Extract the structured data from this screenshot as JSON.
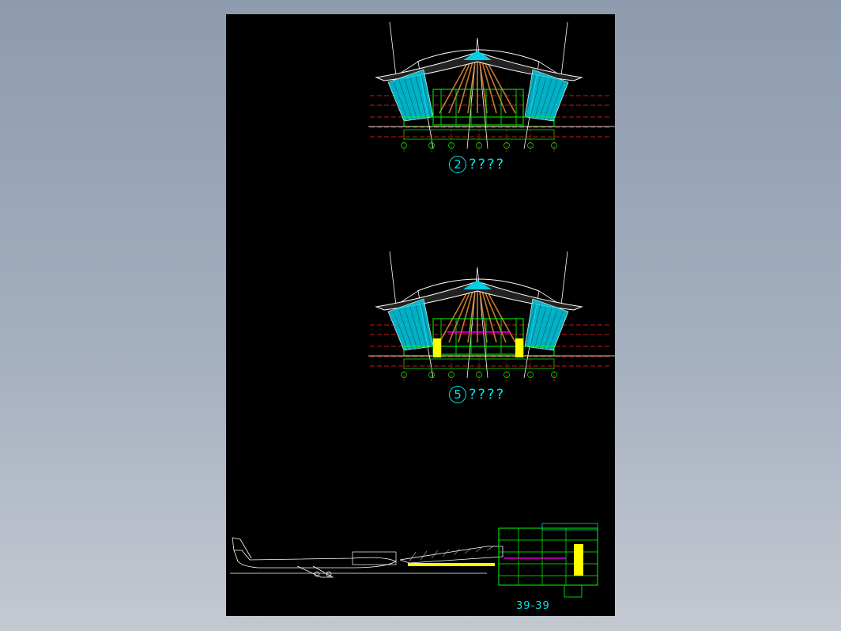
{
  "drawing": {
    "section_a": {
      "number": "2",
      "title": "????"
    },
    "section_b": {
      "number": "5",
      "title": "????"
    },
    "sheet_number": "39-39"
  },
  "colors": {
    "background": "#000000",
    "roof_outline": "#ffffff",
    "glazing": "#00cfe8",
    "structure": "#00ff00",
    "axis": "#ff2020",
    "timber": "#c87830",
    "highlight": "#ffff00",
    "accent": "#ff00ff",
    "label": "#00e5e5"
  }
}
